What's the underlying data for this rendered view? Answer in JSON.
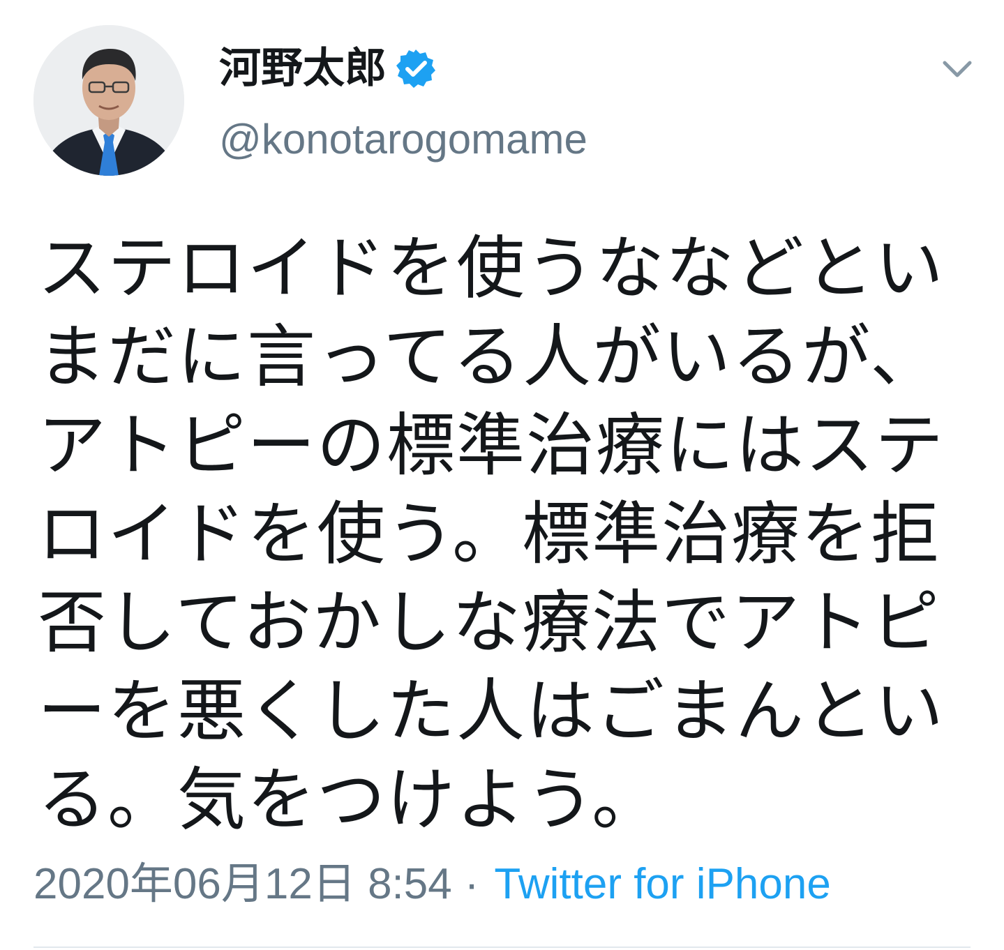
{
  "user": {
    "display_name": "河野太郎",
    "handle": "@konotarogomame",
    "verified_icon": "verified-badge-icon",
    "avatar_icon": "profile-photo"
  },
  "menu": {
    "icon": "chevron-down-icon"
  },
  "tweet": {
    "text": "ステロイドを使うななどといまだに言ってる人がいるが、アトピーの標準治療にはステロイドを使う。標準治療を拒否しておかしな療法でアトピーを悪くした人はごまんといる。気をつけよう。"
  },
  "meta": {
    "timestamp": "2020年06月12日 8:54",
    "separator": "·",
    "source": "Twitter for iPhone"
  },
  "colors": {
    "text": "#14171a",
    "secondary": "#657786",
    "accent": "#1da1f2",
    "divider": "#e1e8ed"
  }
}
